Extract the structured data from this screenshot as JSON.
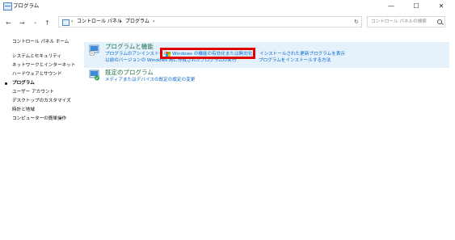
{
  "window": {
    "title": "プログラム",
    "minimize": "—",
    "maximize": "☐",
    "close": "✕"
  },
  "nav": {
    "back": "←",
    "forward": "→",
    "recent": "⌄",
    "up": "↑"
  },
  "address": {
    "sep1": "›",
    "crumb1": "コントロール パネル",
    "sep2": "›",
    "crumb2": "プログラム",
    "sep3": "›",
    "dropdown": "⌄",
    "refresh": "↻"
  },
  "search": {
    "placeholder": "コントロール パネルの検索"
  },
  "sidebar": {
    "items": [
      {
        "label": "コントロール パネル ホーム"
      },
      {
        "label": "システムとセキュリティ"
      },
      {
        "label": "ネットワークとインターネット"
      },
      {
        "label": "ハードウェアとサウンド"
      },
      {
        "label": "プログラム"
      },
      {
        "label": "ユーザー アカウント"
      },
      {
        "label": "デスクトップのカスタマイズ"
      },
      {
        "label": "時計と地域"
      },
      {
        "label": "コンピューターの簡単操作"
      }
    ]
  },
  "categories": {
    "programs_features": {
      "title": "プログラムと機能",
      "links": [
        "プログラムのアンインストール",
        "Windows の機能の有効化または無効化",
        "インストールされた更新プログラムを表示",
        "以前のバージョンの Windows 用に作成されたプログラムの実行",
        "プログラムをインストールする方法"
      ]
    },
    "default_programs": {
      "title": "既定のプログラム",
      "links": [
        "メディアまたはデバイスの既定の設定の変更"
      ]
    }
  },
  "colors": {
    "panel_bg": "#e5f1fb",
    "link": "#0066cc",
    "category_title": "#1e7145",
    "highlight_border": "#e00000"
  }
}
